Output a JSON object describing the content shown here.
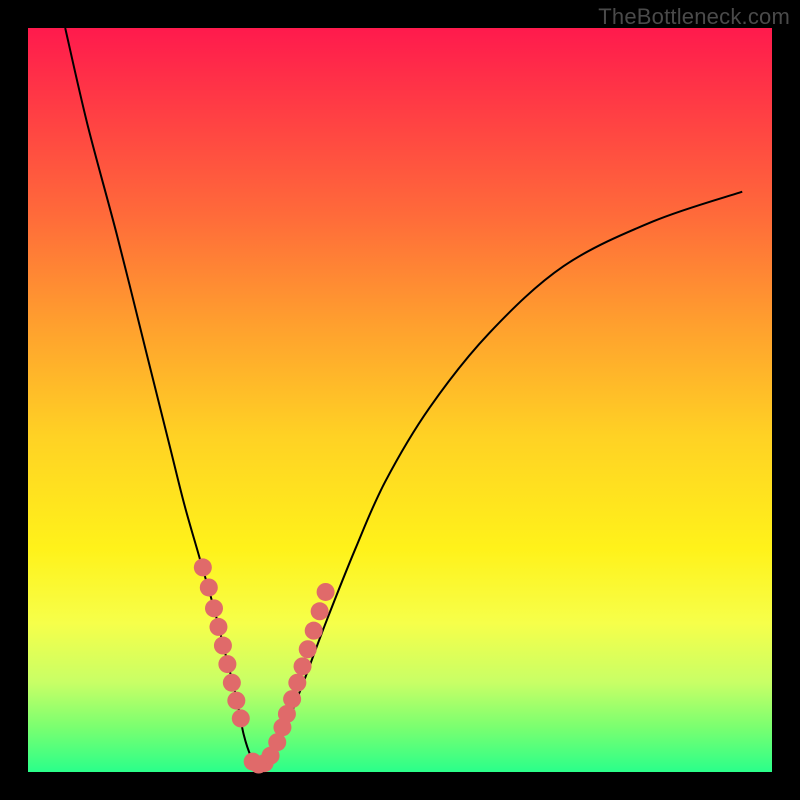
{
  "watermark": "TheBottleneck.com",
  "colors": {
    "frame": "#000000",
    "curve": "#000000",
    "dot_fill": "#e06a6a",
    "dot_stroke": "#c94f4f"
  },
  "chart_data": {
    "type": "line",
    "title": "",
    "xlabel": "",
    "ylabel": "",
    "xlim": [
      0,
      100
    ],
    "ylim": [
      0,
      100
    ],
    "grid": false,
    "legend": false,
    "description": "Single V-shaped bottleneck curve with highlighted points near the minimum",
    "series": [
      {
        "name": "bottleneck-curve",
        "x": [
          5,
          8,
          12,
          16,
          19,
          21,
          23,
          25,
          26.5,
          28,
          29,
          30,
          30.8,
          31.6,
          33,
          35,
          37,
          40,
          44,
          48,
          54,
          62,
          72,
          84,
          96
        ],
        "y": [
          100,
          87,
          72,
          56,
          44,
          36,
          29,
          22,
          16,
          10,
          5,
          2,
          1,
          1.2,
          3,
          7,
          12,
          20,
          30,
          39,
          49,
          59,
          68,
          74,
          78
        ]
      }
    ],
    "highlight_points": {
      "name": "dots",
      "x": [
        23.5,
        24.3,
        25.0,
        25.6,
        26.2,
        26.8,
        27.4,
        28.0,
        28.6,
        30.2,
        31.0,
        31.8,
        32.6,
        33.5,
        34.2,
        34.8,
        35.5,
        36.2,
        36.9,
        37.6,
        38.4,
        39.2,
        40.0
      ],
      "y": [
        27.5,
        24.8,
        22.0,
        19.5,
        17.0,
        14.5,
        12.0,
        9.6,
        7.2,
        1.4,
        1.0,
        1.2,
        2.2,
        4.0,
        6.0,
        7.8,
        9.8,
        12.0,
        14.2,
        16.5,
        19.0,
        21.6,
        24.2
      ]
    }
  }
}
